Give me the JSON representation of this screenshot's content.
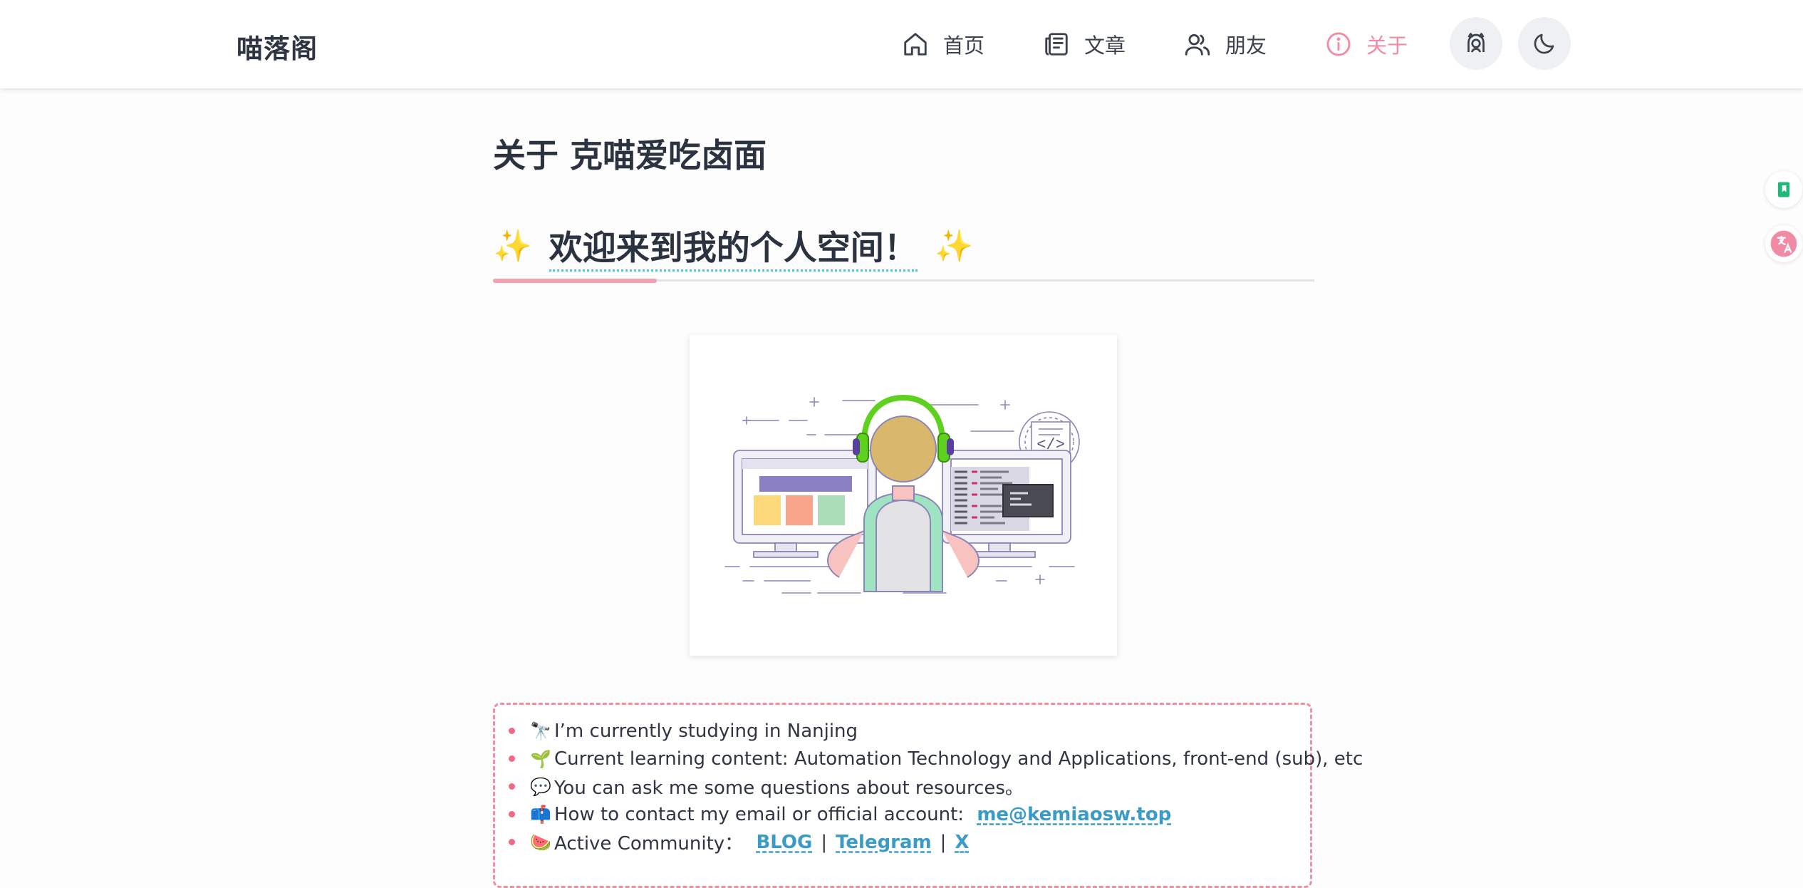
{
  "header": {
    "brand": "喵落阁",
    "nav": [
      {
        "label": "首页",
        "icon": "home-icon"
      },
      {
        "label": "文章",
        "icon": "article-icon"
      },
      {
        "label": "朋友",
        "icon": "friends-icon"
      },
      {
        "label": "关于",
        "icon": "info-icon",
        "active": true
      }
    ],
    "buttons": [
      "avatar-icon",
      "moon-icon"
    ],
    "active_color": "#f48aa0"
  },
  "main": {
    "title": "关于 克喵爱吃卤面",
    "welcome": {
      "left_emoji": "✨",
      "text": "欢迎来到我的个人空间！",
      "right_emoji": "✨"
    },
    "illustration": "developer-at-desk-illustration",
    "info": [
      {
        "emoji": "🔭",
        "text": "I’m currently studying in Nanjing"
      },
      {
        "emoji": "🌱",
        "text": "Current learning content: Automation Technology and Applications, front-end (sub), etc"
      },
      {
        "emoji": "💬",
        "text": "You can ask me some questions about resources。"
      },
      {
        "emoji": "📫",
        "text": "How to contact my email or official account: ",
        "link": "me@kemiaosw.top"
      },
      {
        "emoji": "🍉",
        "text": "Active Community： ",
        "links": [
          "BLOG",
          "Telegram",
          "X"
        ],
        "separator": "|"
      }
    ]
  },
  "side": [
    "bookmark-icon",
    "translate-icon"
  ],
  "colors": {
    "accent": "#f48aa0",
    "link": "#3a9bc7",
    "border": "#f28ea2"
  }
}
